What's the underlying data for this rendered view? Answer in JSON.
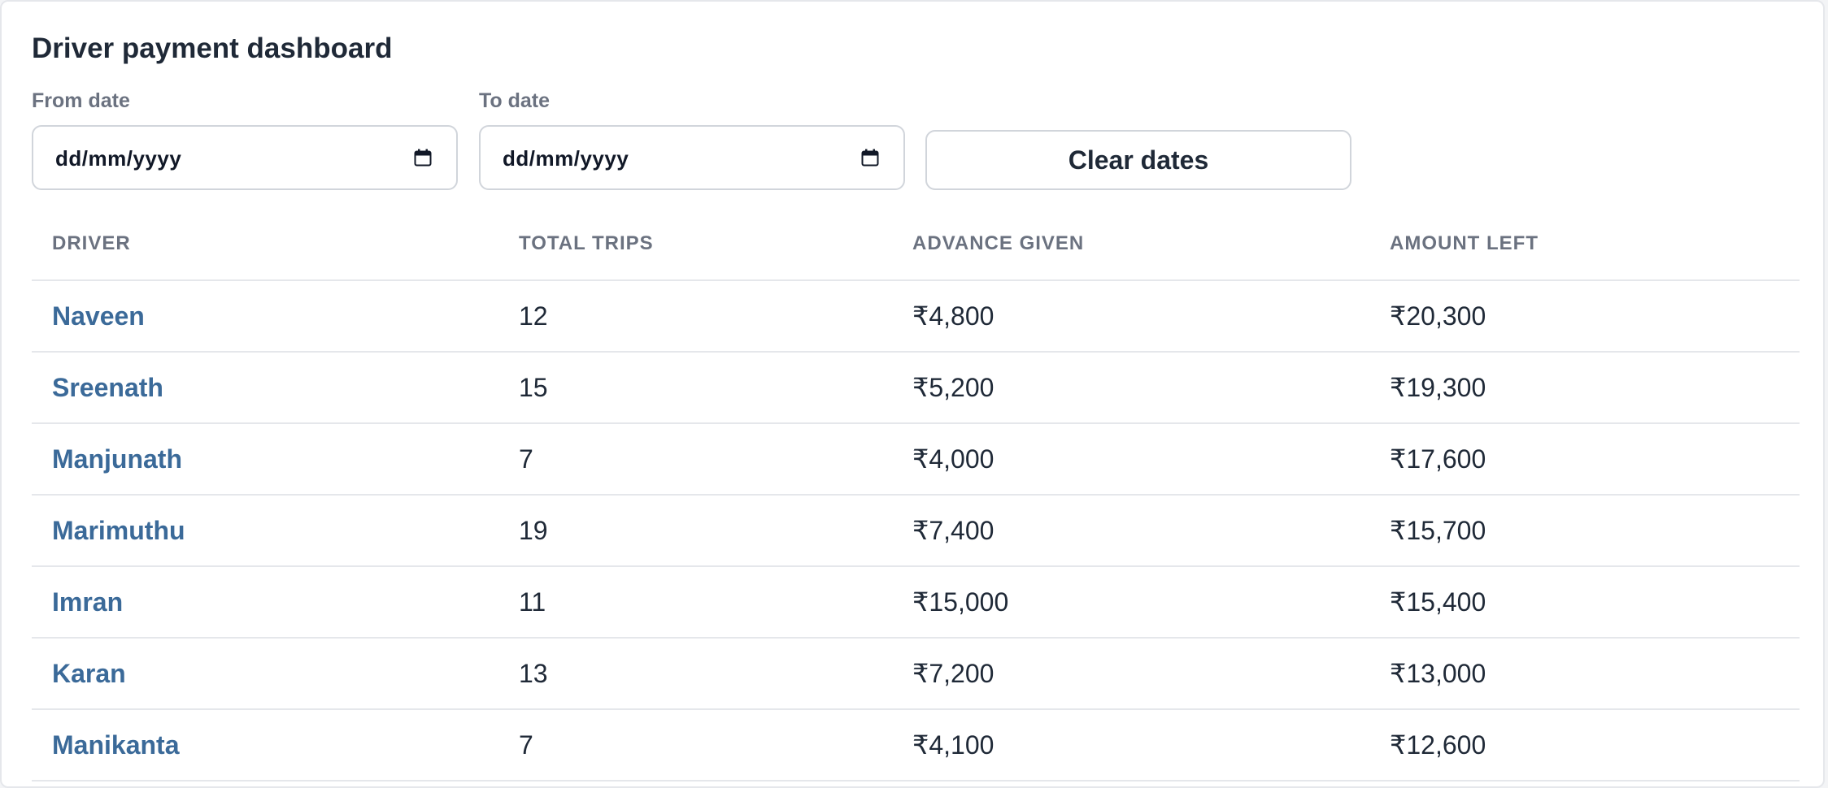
{
  "page": {
    "title": "Driver payment dashboard"
  },
  "filters": {
    "from_label": "From date",
    "from_value": "dd/mm/yyyy",
    "to_label": "To date",
    "to_value": "dd/mm/yyyy",
    "clear_label": "Clear dates"
  },
  "table": {
    "headers": [
      "DRIVER",
      "TOTAL TRIPS",
      "ADVANCE GIVEN",
      "AMOUNT LEFT"
    ],
    "rows": [
      {
        "driver": "Naveen",
        "trips": "12",
        "advance": "₹4,800",
        "left": "₹20,300"
      },
      {
        "driver": "Sreenath",
        "trips": "15",
        "advance": "₹5,200",
        "left": "₹19,300"
      },
      {
        "driver": "Manjunath",
        "trips": "7",
        "advance": "₹4,000",
        "left": "₹17,600"
      },
      {
        "driver": "Marimuthu",
        "trips": "19",
        "advance": "₹7,400",
        "left": "₹15,700"
      },
      {
        "driver": "Imran",
        "trips": "11",
        "advance": "₹15,000",
        "left": "₹15,400"
      },
      {
        "driver": "Karan",
        "trips": "13",
        "advance": "₹7,200",
        "left": "₹13,000"
      },
      {
        "driver": "Manikanta",
        "trips": "7",
        "advance": "₹4,100",
        "left": "₹12,600"
      }
    ]
  },
  "icons": {
    "date_picker": "calendar-icon"
  },
  "colors": {
    "driver_link": "#3b6a99",
    "header_text": "#6b7280",
    "border": "#e5e7eb"
  }
}
